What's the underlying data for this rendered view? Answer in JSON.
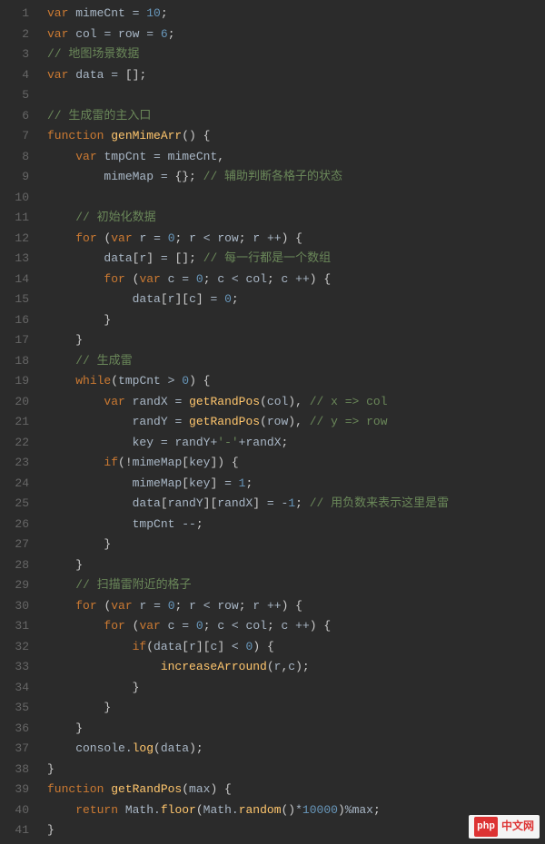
{
  "watermark": {
    "logo": "php",
    "text": "中文网"
  },
  "chart_data": {
    "type": "table",
    "title": "JavaScript source (code editor view)",
    "columns": [
      "line",
      "code"
    ],
    "rows": [
      [
        1,
        "var mimeCnt = 10;"
      ],
      [
        2,
        "var col = row = 6;"
      ],
      [
        3,
        "// 地图场景数据"
      ],
      [
        4,
        "var data = [];"
      ],
      [
        5,
        ""
      ],
      [
        6,
        "// 生成雷的主入口"
      ],
      [
        7,
        "function genMimeArr() {"
      ],
      [
        8,
        "    var tmpCnt = mimeCnt,"
      ],
      [
        9,
        "        mimeMap = {}; // 辅助判断各格子的状态"
      ],
      [
        10,
        ""
      ],
      [
        11,
        "    // 初始化数据"
      ],
      [
        12,
        "    for (var r = 0; r < row; r ++) {"
      ],
      [
        13,
        "        data[r] = []; // 每一行都是一个数组"
      ],
      [
        14,
        "        for (var c = 0; c < col; c ++) {"
      ],
      [
        15,
        "            data[r][c] = 0;"
      ],
      [
        16,
        "        }"
      ],
      [
        17,
        "    }"
      ],
      [
        18,
        "    // 生成雷"
      ],
      [
        19,
        "    while(tmpCnt > 0) {"
      ],
      [
        20,
        "        var randX = getRandPos(col), // x => col"
      ],
      [
        21,
        "            randY = getRandPos(row), // y => row"
      ],
      [
        22,
        "            key = randY+'-'+randX;"
      ],
      [
        23,
        "        if(!mimeMap[key]) {"
      ],
      [
        24,
        "            mimeMap[key] = 1;"
      ],
      [
        25,
        "            data[randY][randX] = -1; // 用负数来表示这里是雷"
      ],
      [
        26,
        "            tmpCnt --;"
      ],
      [
        27,
        "        }"
      ],
      [
        28,
        "    }"
      ],
      [
        29,
        "    // 扫描雷附近的格子"
      ],
      [
        30,
        "    for (var r = 0; r < row; r ++) {"
      ],
      [
        31,
        "        for (var c = 0; c < col; c ++) {"
      ],
      [
        32,
        "            if(data[r][c] < 0) {"
      ],
      [
        33,
        "                increaseArround(r,c);"
      ],
      [
        34,
        "            }"
      ],
      [
        35,
        "        }"
      ],
      [
        36,
        "    }"
      ],
      [
        37,
        "    console.log(data);"
      ],
      [
        38,
        "}"
      ],
      [
        39,
        "function getRandPos(max) {"
      ],
      [
        40,
        "    return Math.floor(Math.random()*10000)%max;"
      ],
      [
        41,
        "}"
      ]
    ]
  },
  "lines": [
    {
      "n": 1,
      "t": [
        [
          "kw",
          "var "
        ],
        [
          "id",
          "mimeCnt "
        ],
        [
          "op",
          "= "
        ],
        [
          "num",
          "10"
        ],
        [
          "pun",
          ";"
        ]
      ]
    },
    {
      "n": 2,
      "t": [
        [
          "kw",
          "var "
        ],
        [
          "id",
          "col "
        ],
        [
          "op",
          "= "
        ],
        [
          "id",
          "row "
        ],
        [
          "op",
          "= "
        ],
        [
          "num",
          "6"
        ],
        [
          "pun",
          ";"
        ]
      ]
    },
    {
      "n": 3,
      "t": [
        [
          "cmt",
          "// 地图场景数据"
        ]
      ]
    },
    {
      "n": 4,
      "t": [
        [
          "kw",
          "var "
        ],
        [
          "id",
          "data "
        ],
        [
          "op",
          "= "
        ],
        [
          "pun",
          "[];"
        ]
      ]
    },
    {
      "n": 5,
      "t": [
        [
          "id",
          ""
        ]
      ]
    },
    {
      "n": 6,
      "t": [
        [
          "cmt",
          "// 生成雷的主入口"
        ]
      ]
    },
    {
      "n": 7,
      "t": [
        [
          "kw",
          "function "
        ],
        [
          "fn",
          "genMimeArr"
        ],
        [
          "pun",
          "() {"
        ]
      ]
    },
    {
      "n": 8,
      "t": [
        [
          "id",
          "    "
        ],
        [
          "kw",
          "var "
        ],
        [
          "id",
          "tmpCnt "
        ],
        [
          "op",
          "= "
        ],
        [
          "id",
          "mimeCnt"
        ],
        [
          "pun",
          ","
        ]
      ]
    },
    {
      "n": 9,
      "t": [
        [
          "id",
          "        mimeMap "
        ],
        [
          "op",
          "= "
        ],
        [
          "pun",
          "{}; "
        ],
        [
          "cmt",
          "// 辅助判断各格子的状态"
        ]
      ]
    },
    {
      "n": 10,
      "t": [
        [
          "id",
          ""
        ]
      ]
    },
    {
      "n": 11,
      "t": [
        [
          "id",
          "    "
        ],
        [
          "cmt",
          "// 初始化数据"
        ]
      ]
    },
    {
      "n": 12,
      "t": [
        [
          "id",
          "    "
        ],
        [
          "kw",
          "for "
        ],
        [
          "pun",
          "("
        ],
        [
          "kw",
          "var "
        ],
        [
          "id",
          "r "
        ],
        [
          "op",
          "= "
        ],
        [
          "num",
          "0"
        ],
        [
          "pun",
          "; "
        ],
        [
          "id",
          "r "
        ],
        [
          "op",
          "< "
        ],
        [
          "id",
          "row"
        ],
        [
          "pun",
          "; "
        ],
        [
          "id",
          "r "
        ],
        [
          "op",
          "++"
        ],
        [
          "pun",
          ") {"
        ]
      ]
    },
    {
      "n": 13,
      "t": [
        [
          "id",
          "        data"
        ],
        [
          "pun",
          "["
        ],
        [
          "id",
          "r"
        ],
        [
          "pun",
          "] "
        ],
        [
          "op",
          "= "
        ],
        [
          "pun",
          "[]; "
        ],
        [
          "cmt",
          "// 每一行都是一个数组"
        ]
      ]
    },
    {
      "n": 14,
      "t": [
        [
          "id",
          "        "
        ],
        [
          "kw",
          "for "
        ],
        [
          "pun",
          "("
        ],
        [
          "kw",
          "var "
        ],
        [
          "id",
          "c "
        ],
        [
          "op",
          "= "
        ],
        [
          "num",
          "0"
        ],
        [
          "pun",
          "; "
        ],
        [
          "id",
          "c "
        ],
        [
          "op",
          "< "
        ],
        [
          "id",
          "col"
        ],
        [
          "pun",
          "; "
        ],
        [
          "id",
          "c "
        ],
        [
          "op",
          "++"
        ],
        [
          "pun",
          ") {"
        ]
      ]
    },
    {
      "n": 15,
      "t": [
        [
          "id",
          "            data"
        ],
        [
          "pun",
          "["
        ],
        [
          "id",
          "r"
        ],
        [
          "pun",
          "]["
        ],
        [
          "id",
          "c"
        ],
        [
          "pun",
          "] "
        ],
        [
          "op",
          "= "
        ],
        [
          "num",
          "0"
        ],
        [
          "pun",
          ";"
        ]
      ]
    },
    {
      "n": 16,
      "t": [
        [
          "id",
          "        "
        ],
        [
          "pun",
          "}"
        ]
      ]
    },
    {
      "n": 17,
      "t": [
        [
          "id",
          "    "
        ],
        [
          "pun",
          "}"
        ]
      ]
    },
    {
      "n": 18,
      "t": [
        [
          "id",
          "    "
        ],
        [
          "cmt",
          "// 生成雷"
        ]
      ]
    },
    {
      "n": 19,
      "t": [
        [
          "id",
          "    "
        ],
        [
          "kw",
          "while"
        ],
        [
          "pun",
          "("
        ],
        [
          "id",
          "tmpCnt "
        ],
        [
          "op",
          "> "
        ],
        [
          "num",
          "0"
        ],
        [
          "pun",
          ") {"
        ]
      ]
    },
    {
      "n": 20,
      "t": [
        [
          "id",
          "        "
        ],
        [
          "kw",
          "var "
        ],
        [
          "id",
          "randX "
        ],
        [
          "op",
          "= "
        ],
        [
          "fn",
          "getRandPos"
        ],
        [
          "pun",
          "("
        ],
        [
          "id",
          "col"
        ],
        [
          "pun",
          "), "
        ],
        [
          "cmt",
          "// x => col"
        ]
      ]
    },
    {
      "n": 21,
      "t": [
        [
          "id",
          "            randY "
        ],
        [
          "op",
          "= "
        ],
        [
          "fn",
          "getRandPos"
        ],
        [
          "pun",
          "("
        ],
        [
          "id",
          "row"
        ],
        [
          "pun",
          "), "
        ],
        [
          "cmt",
          "// y => row"
        ]
      ]
    },
    {
      "n": 22,
      "t": [
        [
          "id",
          "            key "
        ],
        [
          "op",
          "= "
        ],
        [
          "id",
          "randY"
        ],
        [
          "op",
          "+"
        ],
        [
          "str",
          "'-'"
        ],
        [
          "op",
          "+"
        ],
        [
          "id",
          "randX"
        ],
        [
          "pun",
          ";"
        ]
      ]
    },
    {
      "n": 23,
      "t": [
        [
          "id",
          "        "
        ],
        [
          "kw",
          "if"
        ],
        [
          "pun",
          "(!"
        ],
        [
          "id",
          "mimeMap"
        ],
        [
          "pun",
          "["
        ],
        [
          "id",
          "key"
        ],
        [
          "pun",
          "]) {"
        ]
      ]
    },
    {
      "n": 24,
      "t": [
        [
          "id",
          "            mimeMap"
        ],
        [
          "pun",
          "["
        ],
        [
          "id",
          "key"
        ],
        [
          "pun",
          "] "
        ],
        [
          "op",
          "= "
        ],
        [
          "num",
          "1"
        ],
        [
          "pun",
          ";"
        ]
      ]
    },
    {
      "n": 25,
      "t": [
        [
          "id",
          "            data"
        ],
        [
          "pun",
          "["
        ],
        [
          "id",
          "randY"
        ],
        [
          "pun",
          "]["
        ],
        [
          "id",
          "randX"
        ],
        [
          "pun",
          "] "
        ],
        [
          "op",
          "= "
        ],
        [
          "op",
          "-"
        ],
        [
          "num",
          "1"
        ],
        [
          "pun",
          "; "
        ],
        [
          "cmt",
          "// 用负数来表示这里是雷"
        ]
      ]
    },
    {
      "n": 26,
      "t": [
        [
          "id",
          "            tmpCnt "
        ],
        [
          "op",
          "--"
        ],
        [
          "pun",
          ";"
        ]
      ]
    },
    {
      "n": 27,
      "t": [
        [
          "id",
          "        "
        ],
        [
          "pun",
          "}"
        ]
      ]
    },
    {
      "n": 28,
      "t": [
        [
          "id",
          "    "
        ],
        [
          "pun",
          "}"
        ]
      ]
    },
    {
      "n": 29,
      "t": [
        [
          "id",
          "    "
        ],
        [
          "cmt",
          "// 扫描雷附近的格子"
        ]
      ]
    },
    {
      "n": 30,
      "t": [
        [
          "id",
          "    "
        ],
        [
          "kw",
          "for "
        ],
        [
          "pun",
          "("
        ],
        [
          "kw",
          "var "
        ],
        [
          "id",
          "r "
        ],
        [
          "op",
          "= "
        ],
        [
          "num",
          "0"
        ],
        [
          "pun",
          "; "
        ],
        [
          "id",
          "r "
        ],
        [
          "op",
          "< "
        ],
        [
          "id",
          "row"
        ],
        [
          "pun",
          "; "
        ],
        [
          "id",
          "r "
        ],
        [
          "op",
          "++"
        ],
        [
          "pun",
          ") {"
        ]
      ]
    },
    {
      "n": 31,
      "t": [
        [
          "id",
          "        "
        ],
        [
          "kw",
          "for "
        ],
        [
          "pun",
          "("
        ],
        [
          "kw",
          "var "
        ],
        [
          "id",
          "c "
        ],
        [
          "op",
          "= "
        ],
        [
          "num",
          "0"
        ],
        [
          "pun",
          "; "
        ],
        [
          "id",
          "c "
        ],
        [
          "op",
          "< "
        ],
        [
          "id",
          "col"
        ],
        [
          "pun",
          "; "
        ],
        [
          "id",
          "c "
        ],
        [
          "op",
          "++"
        ],
        [
          "pun",
          ") {"
        ]
      ]
    },
    {
      "n": 32,
      "t": [
        [
          "id",
          "            "
        ],
        [
          "kw",
          "if"
        ],
        [
          "pun",
          "("
        ],
        [
          "id",
          "data"
        ],
        [
          "pun",
          "["
        ],
        [
          "id",
          "r"
        ],
        [
          "pun",
          "]["
        ],
        [
          "id",
          "c"
        ],
        [
          "pun",
          "] "
        ],
        [
          "op",
          "< "
        ],
        [
          "num",
          "0"
        ],
        [
          "pun",
          ") {"
        ]
      ]
    },
    {
      "n": 33,
      "t": [
        [
          "id",
          "                "
        ],
        [
          "fn",
          "increaseArround"
        ],
        [
          "pun",
          "("
        ],
        [
          "id",
          "r"
        ],
        [
          "pun",
          ","
        ],
        [
          "id",
          "c"
        ],
        [
          "pun",
          ");"
        ]
      ]
    },
    {
      "n": 34,
      "t": [
        [
          "id",
          "            "
        ],
        [
          "pun",
          "}"
        ]
      ]
    },
    {
      "n": 35,
      "t": [
        [
          "id",
          "        "
        ],
        [
          "pun",
          "}"
        ]
      ]
    },
    {
      "n": 36,
      "t": [
        [
          "id",
          "    "
        ],
        [
          "pun",
          "}"
        ]
      ]
    },
    {
      "n": 37,
      "t": [
        [
          "id",
          "    console."
        ],
        [
          "fn",
          "log"
        ],
        [
          "pun",
          "("
        ],
        [
          "id",
          "data"
        ],
        [
          "pun",
          ");"
        ]
      ]
    },
    {
      "n": 38,
      "t": [
        [
          "pun",
          "}"
        ]
      ]
    },
    {
      "n": 39,
      "t": [
        [
          "kw",
          "function "
        ],
        [
          "fn",
          "getRandPos"
        ],
        [
          "pun",
          "("
        ],
        [
          "id",
          "max"
        ],
        [
          "pun",
          ") {"
        ]
      ]
    },
    {
      "n": 40,
      "t": [
        [
          "id",
          "    "
        ],
        [
          "kw",
          "return "
        ],
        [
          "id",
          "Math."
        ],
        [
          "fn",
          "floor"
        ],
        [
          "pun",
          "("
        ],
        [
          "id",
          "Math."
        ],
        [
          "fn",
          "random"
        ],
        [
          "pun",
          "()"
        ],
        [
          "op",
          "*"
        ],
        [
          "num",
          "10000"
        ],
        [
          "pun",
          ")"
        ],
        [
          "op",
          "%"
        ],
        [
          "id",
          "max"
        ],
        [
          "pun",
          ";"
        ]
      ]
    },
    {
      "n": 41,
      "t": [
        [
          "pun",
          "}"
        ]
      ]
    }
  ]
}
